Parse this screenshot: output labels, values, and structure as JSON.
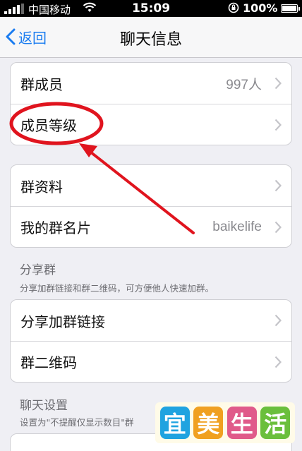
{
  "status_bar": {
    "carrier": "中国移动",
    "time": "15:09",
    "battery_percent": "100%"
  },
  "nav": {
    "back_label": "返回",
    "title": "聊天信息"
  },
  "group_members_section": {
    "rows": [
      {
        "label": "群成员",
        "value": "997人"
      },
      {
        "label": "成员等级",
        "value": ""
      }
    ]
  },
  "group_info_section": {
    "rows": [
      {
        "label": "群资料",
        "value": ""
      },
      {
        "label": "我的群名片",
        "value": "baikelife"
      }
    ]
  },
  "share_section": {
    "title": "分享群",
    "description": "分享加群链接和群二维码，可方便他人快速加群。",
    "rows": [
      {
        "label": "分享加群链接",
        "value": ""
      },
      {
        "label": "群二维码",
        "value": ""
      }
    ]
  },
  "chat_settings_section": {
    "title": "聊天设置",
    "description": "设置为\"不提醒仅显示数目\"群"
  },
  "watermark": {
    "chars": [
      "宜",
      "美",
      "生",
      "活"
    ],
    "colors": [
      "#1fa3e0",
      "#f0a020",
      "#e05a8a",
      "#6abf3c"
    ]
  },
  "colors": {
    "accent": "#1a7cf0",
    "annotation_red": "#e0141e"
  }
}
